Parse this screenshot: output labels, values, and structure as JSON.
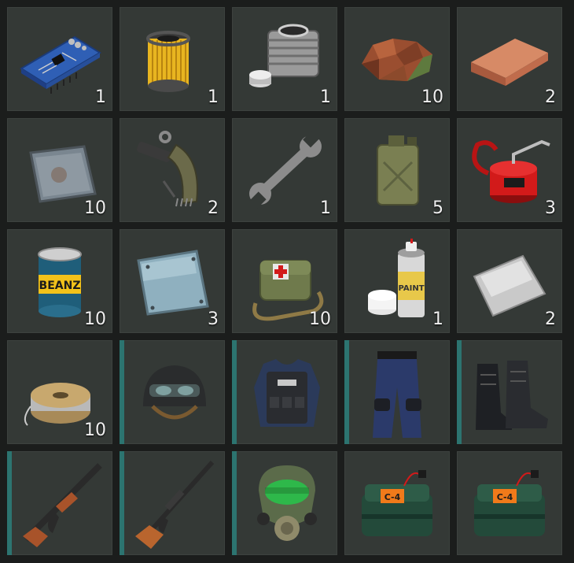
{
  "inventory": {
    "slots": [
      {
        "icon": "circuit-board-icon",
        "qty": "1"
      },
      {
        "icon": "air-filter-icon",
        "qty": "1"
      },
      {
        "icon": "engine-cylinder-icon",
        "qty": "1"
      },
      {
        "icon": "copper-ore-icon",
        "qty": "10"
      },
      {
        "icon": "copper-ingot-icon",
        "qty": "2"
      },
      {
        "icon": "iron-plate-icon",
        "qty": "10"
      },
      {
        "icon": "rifle-magazine-parts-icon",
        "qty": "2"
      },
      {
        "icon": "wrench-icon",
        "qty": "1"
      },
      {
        "icon": "jerry-can-icon",
        "qty": "5"
      },
      {
        "icon": "oil-can-icon",
        "qty": "3"
      },
      {
        "icon": "beans-can-icon",
        "qty": "10"
      },
      {
        "icon": "glass-plate-icon",
        "qty": "3"
      },
      {
        "icon": "medical-bag-icon",
        "qty": "10"
      },
      {
        "icon": "spray-paint-icon",
        "qty": "1"
      },
      {
        "icon": "aluminum-sheet-icon",
        "qty": "2"
      },
      {
        "icon": "wire-spool-icon",
        "qty": "10"
      },
      {
        "icon": "tactical-helmet-icon",
        "qty": ""
      },
      {
        "icon": "police-vest-icon",
        "qty": ""
      },
      {
        "icon": "police-pants-icon",
        "qty": ""
      },
      {
        "icon": "combat-boots-icon",
        "qty": ""
      },
      {
        "icon": "assault-rifle-icon",
        "qty": ""
      },
      {
        "icon": "sniper-rifle-icon",
        "qty": ""
      },
      {
        "icon": "gas-mask-icon",
        "qty": ""
      },
      {
        "icon": "c4-explosive-icon",
        "qty": ""
      },
      {
        "icon": "c4-explosive-icon",
        "qty": ""
      }
    ],
    "labels": {
      "beans": "BEANZ",
      "spray": "PAINT",
      "c4": "C-4"
    },
    "colors": {
      "slot_bg": "#343936",
      "equip_marker": "#2c7470",
      "qty_text": "#f0f0f0"
    }
  }
}
